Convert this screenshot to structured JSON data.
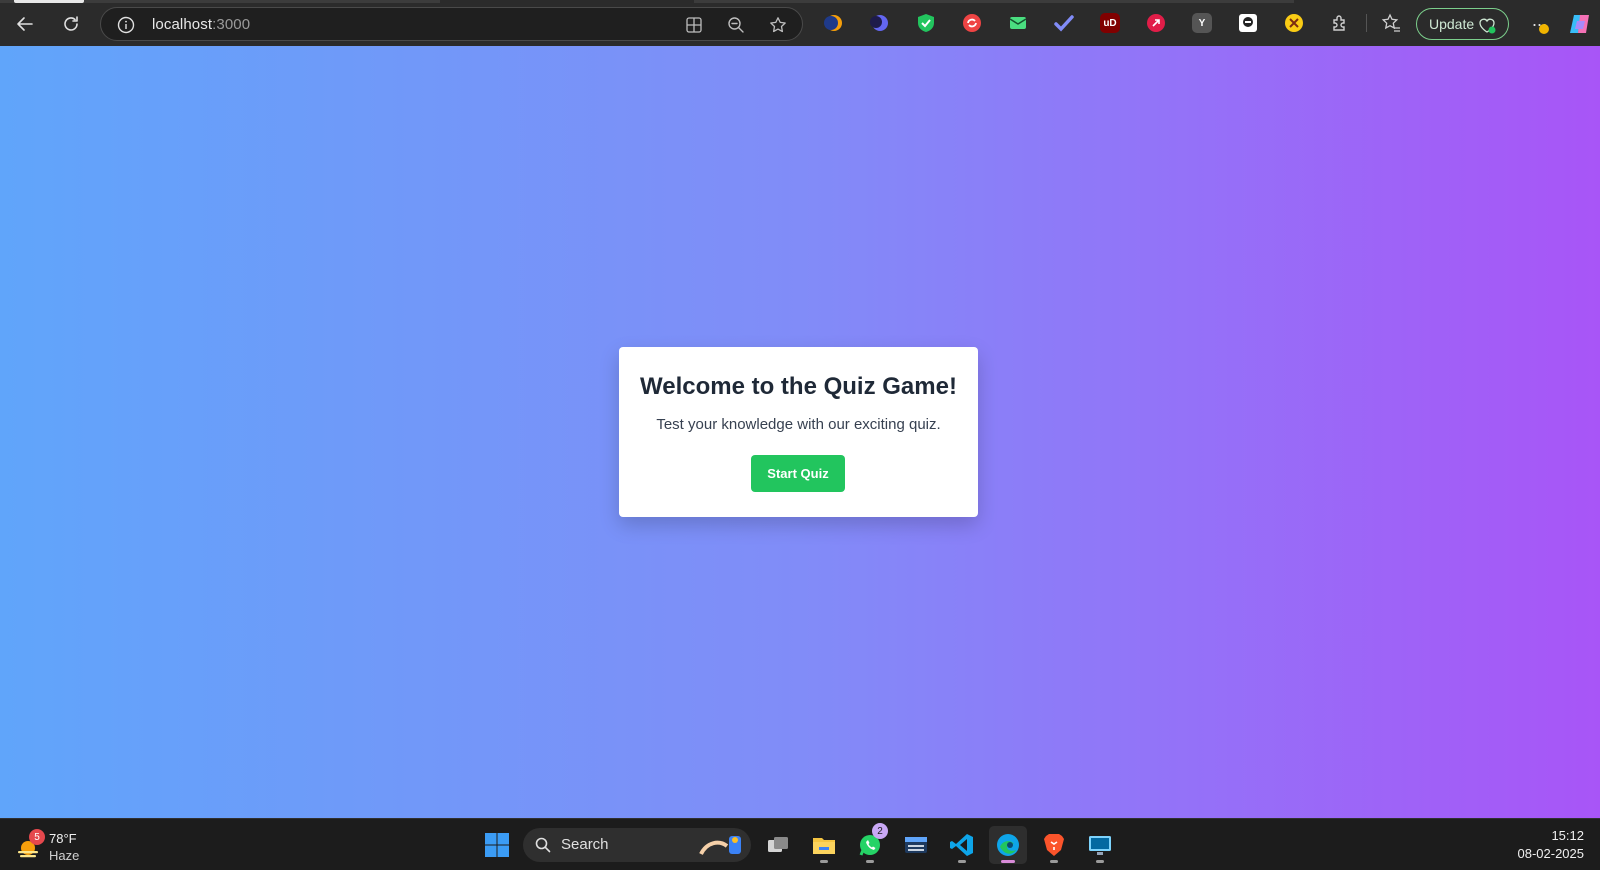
{
  "browser": {
    "url_host": "localhost",
    "url_port": ":3000",
    "update_label": "Update",
    "menu_label": "···",
    "extensions": [
      "ext-orange-moon-icon",
      "ext-blue-moon-icon",
      "ext-shield-icon",
      "ext-red-circle-icon",
      "ext-mail-icon",
      "ext-check-icon",
      "ext-ublock-icon",
      "ext-pink-icon",
      "ext-y-icon",
      "ext-face-icon",
      "ext-yellow-icon"
    ],
    "ublock_text": "uD",
    "y_ext_text": "Y"
  },
  "quiz": {
    "title": "Welcome to the Quiz Game!",
    "subtitle": "Test your knowledge with our exciting quiz.",
    "start_label": "Start Quiz",
    "accent": "#22c55e",
    "gradient_start": "#60a5fa",
    "gradient_end": "#a855f7"
  },
  "taskbar": {
    "weather_temp": "78°F",
    "weather_condition": "Haze",
    "weather_badge": "5",
    "search_label": "Search",
    "whatsapp_badge": "2",
    "time": "15:12",
    "date": "08-02-2025"
  }
}
